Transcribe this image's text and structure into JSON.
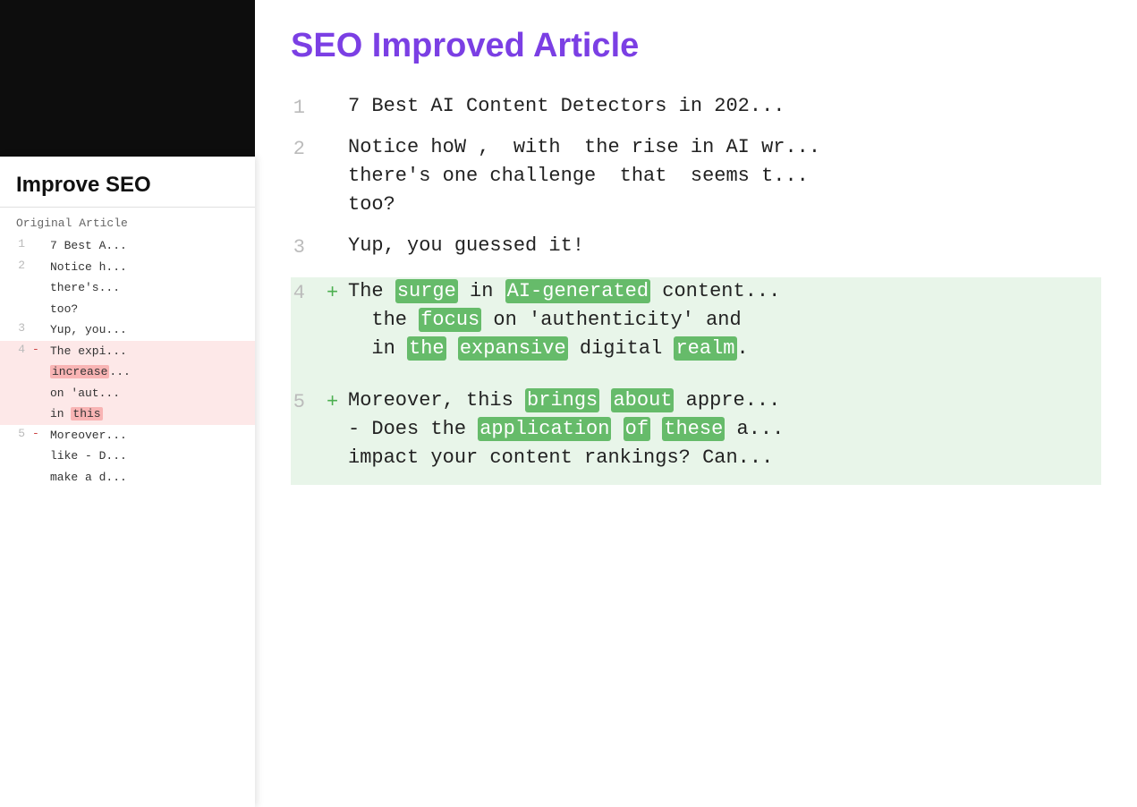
{
  "sidebar": {
    "dark_bg": true,
    "header": "Improve SEO",
    "orig_label": "Original Article",
    "lines": [
      {
        "num": "1",
        "marker": "",
        "text": "7 Best A...",
        "deleted": false
      },
      {
        "num": "2",
        "marker": "",
        "text": "Notice h...",
        "deleted": false
      },
      {
        "num": "",
        "marker": "",
        "text": "there's...",
        "deleted": false
      },
      {
        "num": "",
        "marker": "",
        "text": "too?",
        "deleted": false
      },
      {
        "num": "3",
        "marker": "",
        "text": "Yup, you...",
        "deleted": false
      },
      {
        "num": "4",
        "marker": "-",
        "text": "The expi...",
        "deleted": true
      },
      {
        "num": "",
        "marker": "",
        "text": "increase...",
        "deleted": true,
        "hl": true
      },
      {
        "num": "",
        "marker": "",
        "text": "on 'aut...",
        "deleted": true
      },
      {
        "num": "",
        "marker": "",
        "text": "in ",
        "deleted": true,
        "hl_word": "this"
      },
      {
        "num": "5",
        "marker": "-",
        "text": "Moreover...",
        "deleted": false
      },
      {
        "num": "",
        "marker": "",
        "text": "like - D...",
        "deleted": false
      },
      {
        "num": "",
        "marker": "",
        "text": "make a d...",
        "deleted": false
      }
    ]
  },
  "main": {
    "title": "SEO Improved Article",
    "rows": [
      {
        "num": "1",
        "marker": "",
        "type": "normal",
        "text": "7 Best AI Content Detectors in 202..."
      },
      {
        "num": "2",
        "marker": "",
        "type": "normal",
        "text_parts": [
          {
            "text": "Notice hoW ,",
            "hl": false
          },
          {
            "text": " with",
            "hl": false
          },
          {
            "text": " the rise in AI wr..."
          }
        ],
        "full_line1": "Notice how,  with  the rise in AI wr...",
        "full_line2": "there's one challenge  that  seems t...",
        "full_line3": "too?"
      },
      {
        "num": "3",
        "marker": "",
        "type": "normal",
        "text": "Yup, you guessed it!"
      },
      {
        "num": "4",
        "marker": "+",
        "type": "added",
        "text_line1_pre": "The ",
        "text_line1_hl1": "surge",
        "text_line1_mid1": " in ",
        "text_line1_hl2": "AI-generated",
        "text_line1_mid2": " content...",
        "text_line2_pre": "  the ",
        "text_line2_hl1": "focus",
        "text_line2_mid1": " on 'authenticity' and ",
        "text_line3_pre": "  in ",
        "text_line3_hl1": "the",
        "text_line3_mid1": " ",
        "text_line3_hl2": "expansive",
        "text_line3_mid2": " digital ",
        "text_line3_hl3": "realm",
        "text_line3_end": "."
      },
      {
        "num": "5",
        "marker": "+",
        "type": "added_mixed",
        "line1_pre": "Moreover, this ",
        "line1_hl1": "brings",
        "line1_mid": " ",
        "line1_hl2": "about",
        "line1_rest": " appre...",
        "line2": "- Does the ",
        "line2_hl1": "application",
        "line2_mid": " ",
        "line2_hl2": "of",
        "line2_mid2": " ",
        "line2_hl3": "these",
        "line2_rest": " a...",
        "line3": "impact your content rankings? Can..."
      }
    ]
  }
}
